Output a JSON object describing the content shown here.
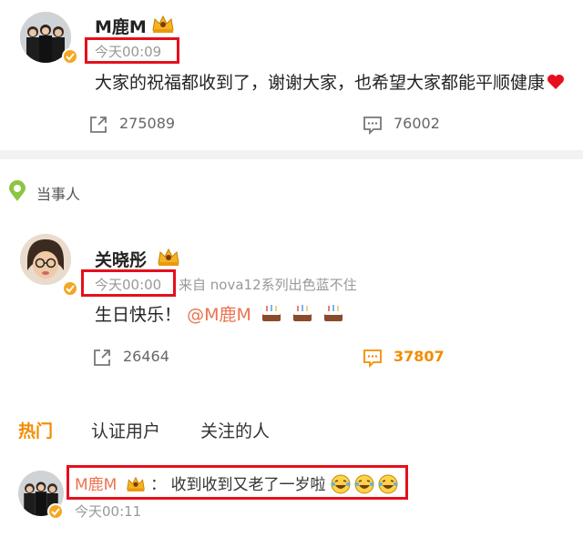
{
  "post1": {
    "username": "M鹿M",
    "time": "今天00:09",
    "content": "大家的祝福都收到了，谢谢大家，也希望大家都能平顺健康",
    "repost_count": "275089",
    "comment_count": "76002"
  },
  "section_label": "当事人",
  "post2": {
    "username": "关晓彤",
    "time": "今天00:00",
    "source": "来自 nova12系列出色蓝不住",
    "content_text": "生日快乐！",
    "mention": "@M鹿M",
    "repost_count": "26464",
    "comment_count": "37807"
  },
  "tabs": {
    "hot": "热门",
    "verified_users": "认证用户",
    "following": "关注的人"
  },
  "comment": {
    "username": "M鹿M",
    "separator": "：",
    "text": "收到收到又老了一岁啦",
    "time": "今天00:11"
  },
  "colors": {
    "accent_orange": "#f28c00",
    "mention": "#eb7350",
    "highlight_box": "#e5101c",
    "verified_badge": "#f5a623"
  }
}
